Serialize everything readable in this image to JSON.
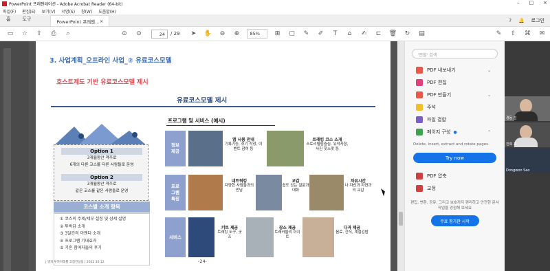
{
  "window": {
    "title": "PowerPoint 프레젠테이션 - Adobe Acrobat Reader (64-bit)"
  },
  "menu": [
    "파일(F)",
    "편집(E)",
    "보기(V)",
    "서명(S)",
    "창(W)",
    "도움말(H)"
  ],
  "tabs": {
    "home": "홈",
    "tools": "도구",
    "doc": "PowerPoint 프레젠..."
  },
  "header": {
    "login": "로그인"
  },
  "toolbar": {
    "page": "24",
    "page_total": "/ 29",
    "zoom": "85%"
  },
  "rightpane": {
    "search_placeholder": "'분할' 검색",
    "items": [
      {
        "label": "PDF 내보내기",
        "color": "#e8574a"
      },
      {
        "label": "PDF 편집",
        "color": "#e0407b"
      },
      {
        "label": "PDF 만들기",
        "color": "#e8574a"
      },
      {
        "label": "주석",
        "color": "#f2c028"
      },
      {
        "label": "파일 결합",
        "color": "#7b5fc7"
      },
      {
        "label": "페이지 구성",
        "color": "#3fa34d"
      },
      {
        "label": "PDF 압축",
        "color": "#d04040"
      },
      {
        "label": "교정",
        "color": "#d04040"
      }
    ],
    "desc": "Delete, insert, extract and rotate pages.",
    "try_now": "Try now",
    "promo": "편집, 변환, 공유, 그리고 보호까지 편리하고 안전한 문서 작업을 경험해 보세요",
    "free_button": "무료 평가판 시작"
  },
  "video": [
    {
      "label": "경동 김"
    },
    {
      "label": "진희 조"
    },
    {
      "label": "Dongwon Seo"
    }
  ],
  "slide": {
    "title": "3. 사업계획_오프라인 사업_② 유료코스모델",
    "subtitle": "호스트제도 기반 유료코스모델 제시",
    "heading": "유료코스모델 제시",
    "program": "프로그램 및 서비스 (예시)",
    "option1": {
      "title": "Option 1",
      "l1": "3개월동안 격주로",
      "l2": "6개의 다른 코스를 다른 사람들로 운영"
    },
    "option2": {
      "title": "Option 2",
      "l1": "3개월동안 격주로",
      "l2": "같은 코스를 같은 사람들로 운영"
    },
    "features_title": "코스별 소개 항목",
    "features": [
      "① 코스의 주제/세부 설정 및 상세 설명",
      "② 투박감 소개",
      "③ 3달간의 아젠다 소개",
      "④ 프로그램 기대효과",
      "⑤ 기존 참여자들의 후기"
    ],
    "cats": [
      "정보\n제공",
      "프로\n그램\n특징",
      "서비스"
    ],
    "captions": {
      "c1": {
        "t": "앱 사용 안내",
        "d": "기록기능, 후기 작성, 이벤트 참여 등"
      },
      "c2": {
        "t": "트래킹 코스 소개",
        "d": "스토리텔링중심, 유적사항, 사진 핫스팟 등"
      },
      "c3": {
        "t": "네트워킹",
        "d": "다양한 사람들과의 만남"
      },
      "c4": {
        "t": "교감",
        "d": "쉽도 있는 질문과 대화"
      },
      "c5": {
        "t": "자유시간",
        "d": "나 자신과 자연과의 교감"
      },
      "c6": {
        "t": "키트 제공",
        "d": "트래킹 도구, 굿즈"
      },
      "c7": {
        "t": "장소 제공",
        "d": "트래커들의 아지트"
      },
      "c8": {
        "t": "다과 제공",
        "d": "음료, 간식, 계절김밥"
      }
    },
    "footer": "| 명학 투자미래를 코칭컨설팅 | 2022.10.12",
    "page_number": "-24-"
  }
}
